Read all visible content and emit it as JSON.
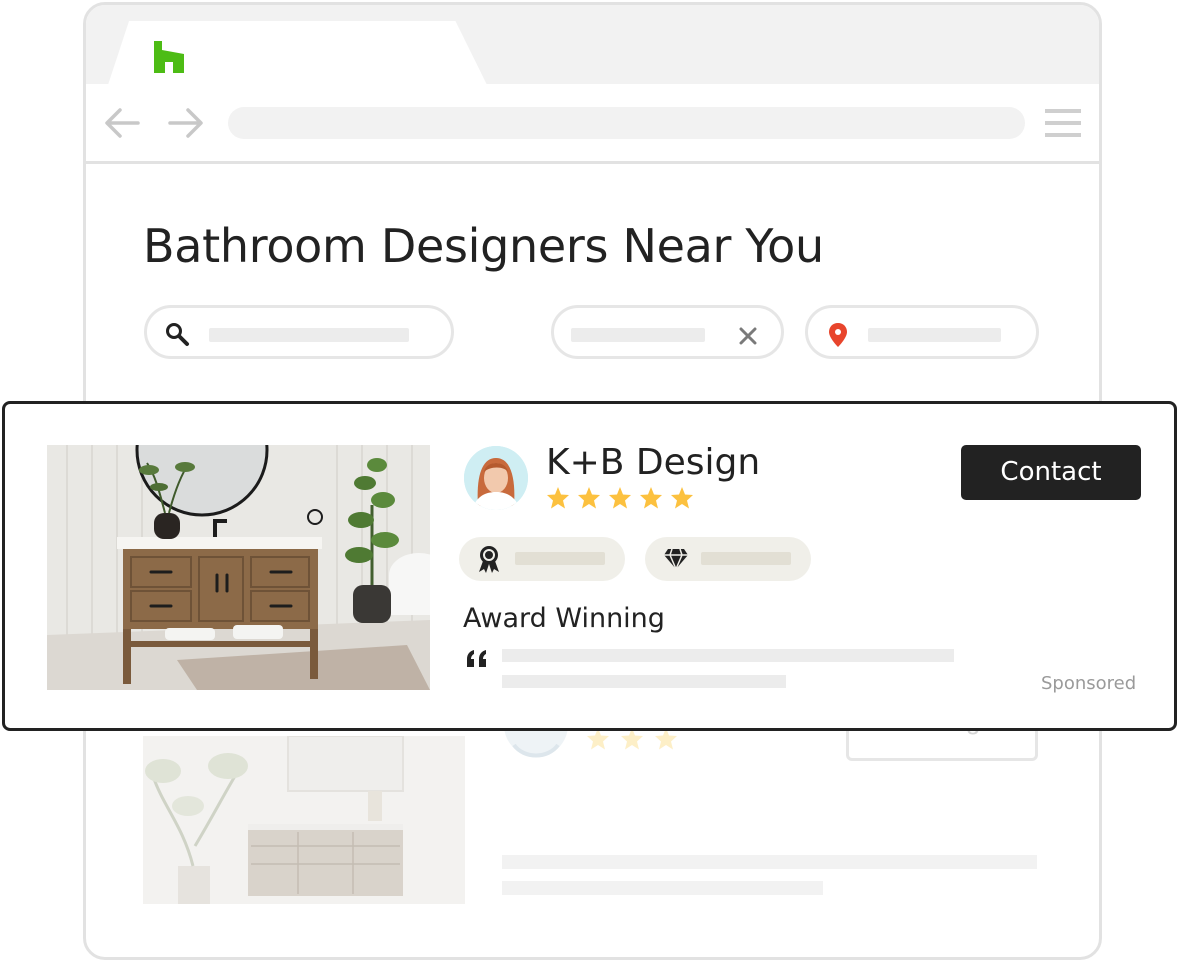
{
  "brand": {
    "logo_icon": "houzz-logo-icon",
    "color": "#4dbc15"
  },
  "page": {
    "title": "Bathroom Designers Near You"
  },
  "search": {
    "icon": "search-icon",
    "clear_icon": "close-icon",
    "location_icon": "map-pin-icon"
  },
  "featured": {
    "business_name": "K+B Design",
    "rating_stars": 5,
    "contact_label": "Contact",
    "badges": [
      "award-icon",
      "diamond-icon"
    ],
    "award_label": "Award Winning",
    "sponsored_label": "Sponsored"
  },
  "background_listing": {
    "message_label": "Message",
    "rating_stars_visible": 3
  },
  "colors": {
    "star": "#fcc13f",
    "button": "#222222",
    "pin": "#e8452c"
  }
}
